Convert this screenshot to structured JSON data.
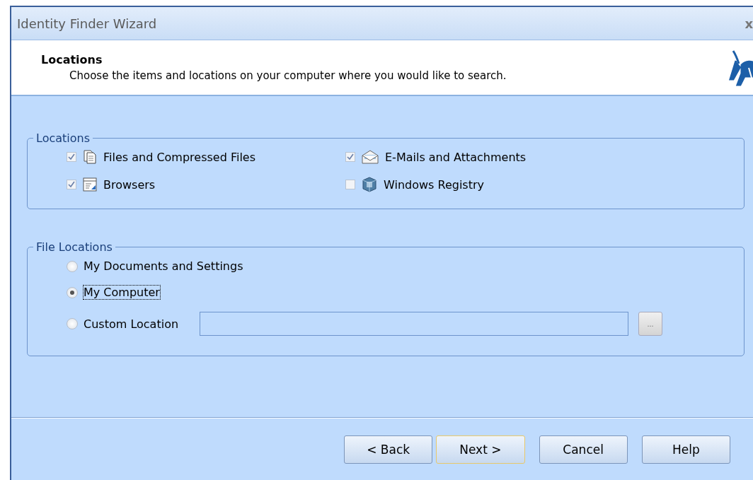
{
  "window": {
    "title": "Identity Finder Wizard",
    "close": "x"
  },
  "header": {
    "title": "Locations",
    "subtitle": "Choose the items and locations on your computer where you would like to search."
  },
  "locations": {
    "legend": "Locations",
    "items": [
      {
        "label": "Files and Compressed Files",
        "checked": true
      },
      {
        "label": "E-Mails and Attachments",
        "checked": true
      },
      {
        "label": "Browsers",
        "checked": true
      },
      {
        "label": "Windows Registry",
        "checked": false
      }
    ]
  },
  "file_locations": {
    "legend": "File Locations",
    "options": [
      {
        "label": "My Documents and Settings",
        "selected": false,
        "focused": false
      },
      {
        "label": "My Computer",
        "selected": true,
        "focused": true
      },
      {
        "label": "Custom Location",
        "selected": false,
        "focused": false
      }
    ],
    "browse_button": "..."
  },
  "buttons": [
    {
      "label": "< Back",
      "default": false
    },
    {
      "label": "Next >",
      "default": true
    },
    {
      "label": "Cancel",
      "default": false
    },
    {
      "label": "Help",
      "default": false
    }
  ]
}
